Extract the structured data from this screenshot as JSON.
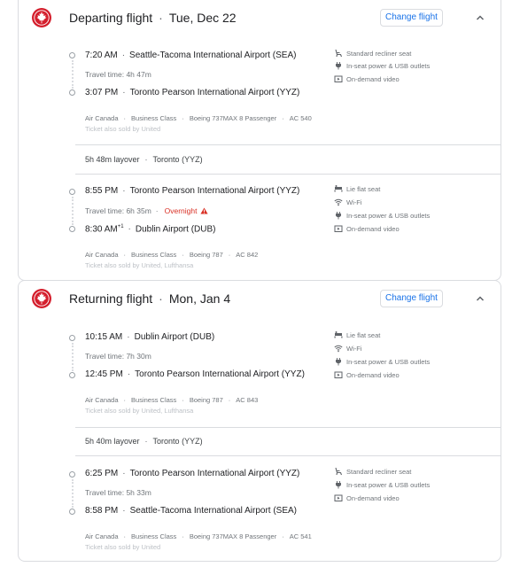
{
  "departing": {
    "title": "Departing flight",
    "date": "Tue, Dec 22",
    "change_label": "Change flight",
    "seg1": {
      "dep_time": "7:20 AM",
      "dep_airport": "Seattle-Tacoma International Airport (SEA)",
      "travel_time": "Travel time: 4h 47m",
      "arr_time": "3:07 PM",
      "arr_airport": "Toronto Pearson International Airport (YYZ)",
      "airline": "Air Canada",
      "cabin": "Business Class",
      "aircraft": "Boeing 737MAX 8 Passenger",
      "flight_no": "AC 540",
      "sold_by": "Ticket also sold by United",
      "amenities": [
        "Standard recliner seat",
        "In-seat power & USB outlets",
        "On-demand video"
      ]
    },
    "layover": {
      "duration": "5h 48m layover",
      "city": "Toronto (YYZ)"
    },
    "seg2": {
      "dep_time": "8:55 PM",
      "dep_airport": "Toronto Pearson International Airport (YYZ)",
      "travel_time": "Travel time: 6h 35m",
      "overnight": "Overnight",
      "arr_time": "8:30 AM",
      "arr_day_offset": "+1",
      "arr_airport": "Dublin Airport (DUB)",
      "airline": "Air Canada",
      "cabin": "Business Class",
      "aircraft": "Boeing 787",
      "flight_no": "AC 842",
      "sold_by": "Ticket also sold by United, Lufthansa",
      "amenities": [
        "Lie flat seat",
        "Wi-Fi",
        "In-seat power & USB outlets",
        "On-demand video"
      ]
    }
  },
  "returning": {
    "title": "Returning flight",
    "date": "Mon, Jan 4",
    "change_label": "Change flight",
    "seg1": {
      "dep_time": "10:15 AM",
      "dep_airport": "Dublin Airport (DUB)",
      "travel_time": "Travel time: 7h 30m",
      "arr_time": "12:45 PM",
      "arr_airport": "Toronto Pearson International Airport (YYZ)",
      "airline": "Air Canada",
      "cabin": "Business Class",
      "aircraft": "Boeing 787",
      "flight_no": "AC 843",
      "sold_by": "Ticket also sold by United, Lufthansa",
      "amenities": [
        "Lie flat seat",
        "Wi-Fi",
        "In-seat power & USB outlets",
        "On-demand video"
      ]
    },
    "layover": {
      "duration": "5h 40m layover",
      "city": "Toronto (YYZ)"
    },
    "seg2": {
      "dep_time": "6:25 PM",
      "dep_airport": "Toronto Pearson International Airport (YYZ)",
      "travel_time": "Travel time: 5h 33m",
      "arr_time": "8:58 PM",
      "arr_airport": "Seattle-Tacoma International Airport (SEA)",
      "airline": "Air Canada",
      "cabin": "Business Class",
      "aircraft": "Boeing 737MAX 8 Passenger",
      "flight_no": "AC 541",
      "sold_by": "Ticket also sold by United",
      "amenities": [
        "Standard recliner seat",
        "In-seat power & USB outlets",
        "On-demand video"
      ]
    }
  },
  "icons": {
    "airline_logo": "air-canada-maple-leaf-icon",
    "collapse": "chevron-up-icon",
    "recliner": "recliner-seat-icon",
    "flat": "lie-flat-seat-icon",
    "wifi": "wifi-icon",
    "power": "power-plug-icon",
    "video": "video-icon",
    "warning": "warning-icon"
  },
  "colors": {
    "brand": "#d41e2c",
    "link": "#1a73e8",
    "warning": "#d93025"
  }
}
